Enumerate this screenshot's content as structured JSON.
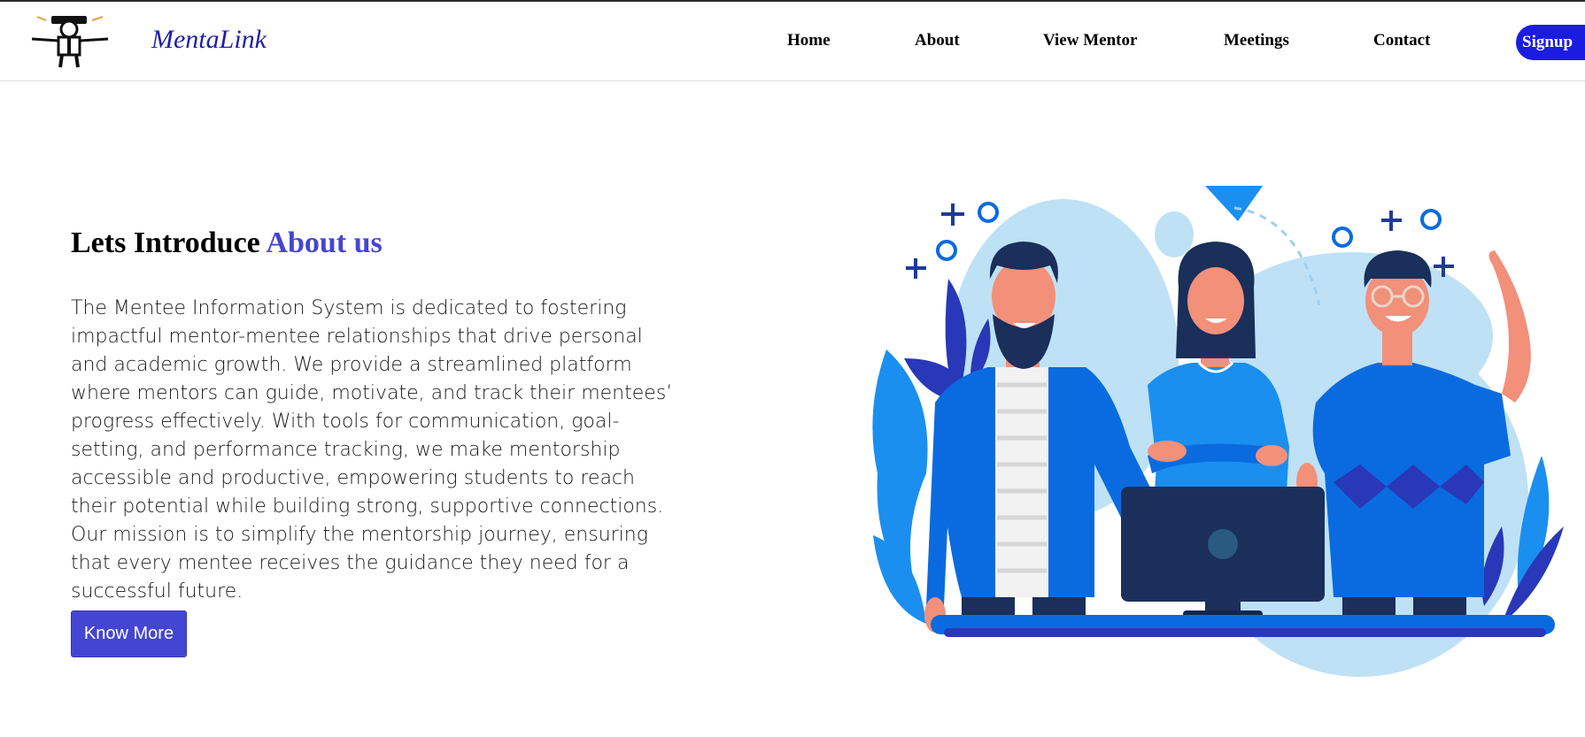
{
  "brand": {
    "name": "MentaLink",
    "logo_icon": "mentor-figure-logo-icon"
  },
  "nav": {
    "items": [
      {
        "label": "Home"
      },
      {
        "label": "About"
      },
      {
        "label": "View Mentor"
      },
      {
        "label": "Meetings"
      },
      {
        "label": "Contact"
      }
    ],
    "signup_label": "Signup"
  },
  "about": {
    "heading_prefix": "Lets Introduce",
    "heading_accent": "About us",
    "paragraph": "The Mentee Information System is dedicated to fostering impactful mentor-mentee relationships that drive personal and academic growth. We provide a streamlined platform where mentors can guide, motivate, and track their mentees’ progress effectively. With tools for communication, goal-setting, and performance tracking, we make mentorship accessible and productive, empowering students to reach their potential while building strong, supportive connections. Our mission is to simplify the mentorship journey, ensuring that every mentee receives the guidance they need for a successful future.",
    "button_label": "Know More"
  },
  "colors": {
    "brand": "#1f1fa8",
    "accent": "#4545d4",
    "signup": "#1c1ce0",
    "illustration_primary": "#0a6be0",
    "illustration_dark": "#1a2f5a",
    "illustration_light": "#bfe1f5"
  },
  "illustration": {
    "icon": "team-mentorship-illustration"
  }
}
